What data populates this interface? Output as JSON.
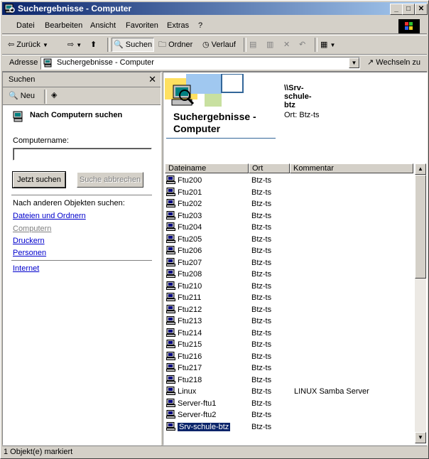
{
  "title": "Suchergebnisse - Computer",
  "menu": [
    {
      "label": "Datei"
    },
    {
      "label": "Bearbeiten"
    },
    {
      "label": "Ansicht"
    },
    {
      "label": "Favoriten"
    },
    {
      "label": "Extras"
    },
    {
      "label": "?"
    }
  ],
  "toolbar": {
    "back": "Zurück",
    "search": "Suchen",
    "folders": "Ordner",
    "history": "Verlauf"
  },
  "address": {
    "label": "Adresse",
    "value": "Suchergebnisse - Computer",
    "go": "Wechseln zu"
  },
  "search_pane": {
    "header": "Suchen",
    "new": "Neu",
    "heading": "Nach Computern suchen",
    "computer_name_label": "Computername:",
    "computer_name_value": "",
    "search_now": "Jetzt suchen",
    "stop_search": "Suche abbrechen",
    "other_label": "Nach anderen Objekten suchen:",
    "links": [
      {
        "label": "Dateien und Ordnern",
        "active": true
      },
      {
        "label": "Computern",
        "active": false
      },
      {
        "label": "Druckern",
        "active": true
      },
      {
        "label": "Personen",
        "active": true
      }
    ],
    "internet": "Internet"
  },
  "results": {
    "title_line1": "Suchergebnisse -",
    "title_line2": "Computer",
    "server_line1": "\\\\Srv-",
    "server_line2": "schule-",
    "server_line3": "btz",
    "location": "Ort: Btz-ts",
    "columns": [
      "Dateiname",
      "Ort",
      "Kommentar"
    ],
    "rows": [
      {
        "name": "Ftu200",
        "location": "Btz-ts",
        "comment": ""
      },
      {
        "name": "Ftu201",
        "location": "Btz-ts",
        "comment": ""
      },
      {
        "name": "Ftu202",
        "location": "Btz-ts",
        "comment": ""
      },
      {
        "name": "Ftu203",
        "location": "Btz-ts",
        "comment": ""
      },
      {
        "name": "Ftu204",
        "location": "Btz-ts",
        "comment": ""
      },
      {
        "name": "Ftu205",
        "location": "Btz-ts",
        "comment": ""
      },
      {
        "name": "Ftu206",
        "location": "Btz-ts",
        "comment": ""
      },
      {
        "name": "Ftu207",
        "location": "Btz-ts",
        "comment": ""
      },
      {
        "name": "Ftu208",
        "location": "Btz-ts",
        "comment": ""
      },
      {
        "name": "Ftu210",
        "location": "Btz-ts",
        "comment": ""
      },
      {
        "name": "Ftu211",
        "location": "Btz-ts",
        "comment": ""
      },
      {
        "name": "Ftu212",
        "location": "Btz-ts",
        "comment": ""
      },
      {
        "name": "Ftu213",
        "location": "Btz-ts",
        "comment": ""
      },
      {
        "name": "Ftu214",
        "location": "Btz-ts",
        "comment": ""
      },
      {
        "name": "Ftu215",
        "location": "Btz-ts",
        "comment": ""
      },
      {
        "name": "Ftu216",
        "location": "Btz-ts",
        "comment": ""
      },
      {
        "name": "Ftu217",
        "location": "Btz-ts",
        "comment": ""
      },
      {
        "name": "Ftu218",
        "location": "Btz-ts",
        "comment": ""
      },
      {
        "name": "Linux",
        "location": "Btz-ts",
        "comment": "LINUX Samba Server"
      },
      {
        "name": "Server-ftu1",
        "location": "Btz-ts",
        "comment": ""
      },
      {
        "name": "Server-ftu2",
        "location": "Btz-ts",
        "comment": ""
      },
      {
        "name": "Srv-schule-btz",
        "location": "Btz-ts",
        "comment": "",
        "selected": true
      }
    ]
  },
  "status": "1 Objekt(e) markiert",
  "colors": {
    "titlebar": "#0a246a",
    "selection": "#0a246a",
    "link": "#0000cc"
  }
}
